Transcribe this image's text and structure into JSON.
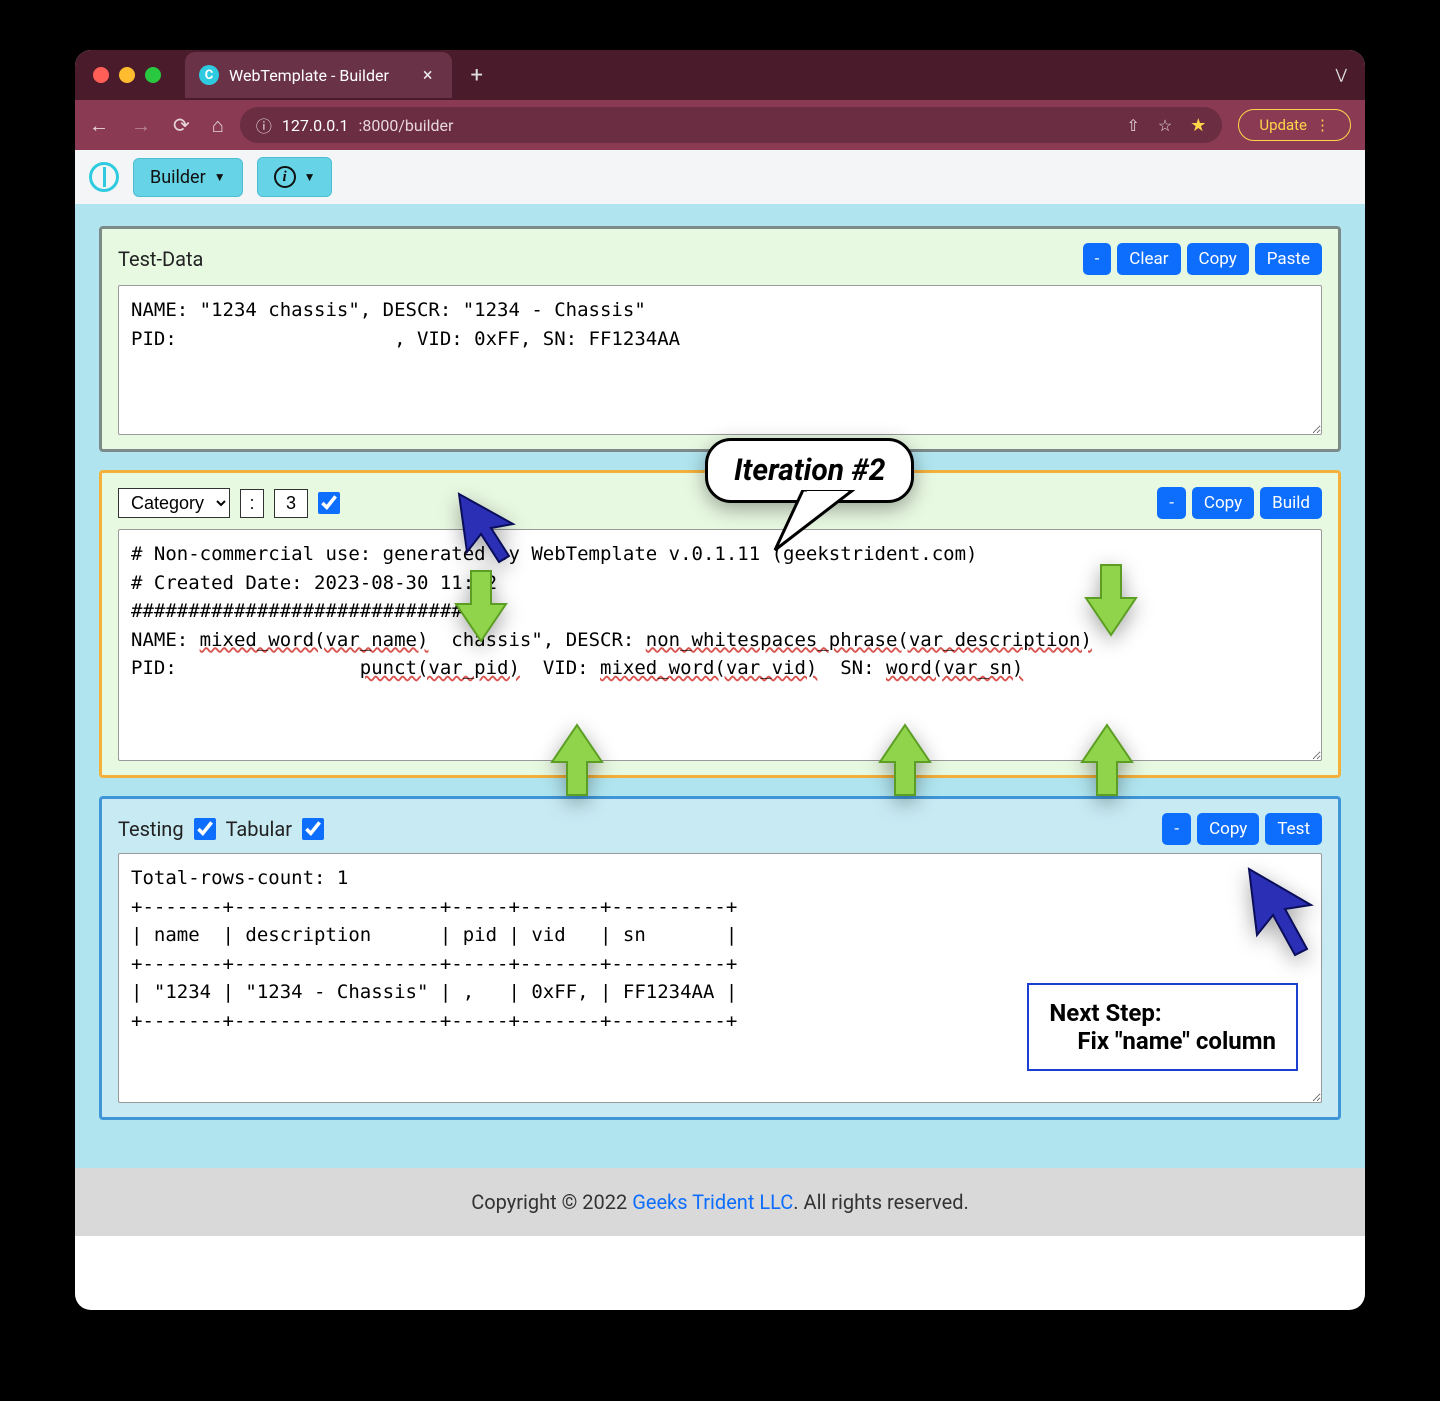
{
  "browser": {
    "tab_title": "WebTemplate - Builder",
    "url_host": "127.0.0.1",
    "url_path": ":8000/builder",
    "update_label": "Update"
  },
  "appbar": {
    "builder_label": "Builder",
    "info_label": "i"
  },
  "panel_testdata": {
    "title": "Test-Data",
    "clear": "Clear",
    "copy": "Copy",
    "paste": "Paste",
    "minus": "-",
    "content": "NAME: \"1234 chassis\", DESCR: \"1234 - Chassis\"\nPID:                   , VID: 0xFF, SN: FF1234AA"
  },
  "panel_template": {
    "select_value": "Category",
    "sep": ":",
    "count": "3",
    "copy": "Copy",
    "build": "Build",
    "minus": "-",
    "content_line1": "# Non-commercial use: generated by WebTemplate v.0.1.11 (geekstrident.com)",
    "content_line2": "# Created Date: 2023-08-30 11:22",
    "content_line3": "################################",
    "content_line4a": "NAME: ",
    "content_line4b": "mixed_word(var_name)",
    "content_line4c": "  chassis\", DESCR: ",
    "content_line4d": "non_whitespaces_phrase(var_description)",
    "content_line5a": "PID:                ",
    "content_line5b": "punct(var_pid)",
    "content_line5c": "  VID: ",
    "content_line5d": "mixed_word(var_vid)",
    "content_line5e": "  SN: ",
    "content_line5f": "word(var_sn)"
  },
  "panel_testing": {
    "testing_label": "Testing",
    "tabular_label": "Tabular",
    "copy": "Copy",
    "test": "Test",
    "minus": "-",
    "content": "Total-rows-count: 1\n+-------+------------------+-----+-------+----------+\n| name  | description      | pid | vid   | sn       |\n+-------+------------------+-----+-------+----------+\n| \"1234 | \"1234 - Chassis\" | ,   | 0xFF, | FF1234AA |\n+-------+------------------+-----+-------+----------+"
  },
  "annotations": {
    "iteration": "Iteration #2",
    "next_step_title": "Next Step:",
    "next_step_body": "Fix \"name\" column"
  },
  "footer": {
    "prefix": "Copyright © 2022 ",
    "link": "Geeks Trident LLC",
    "suffix": ". All rights reserved."
  }
}
